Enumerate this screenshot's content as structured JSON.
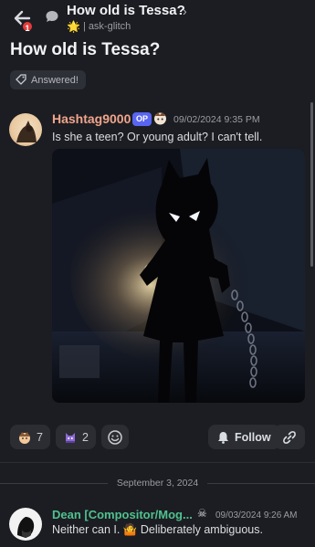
{
  "header": {
    "title": "How old is Tessa?",
    "chevron": "›",
    "notification_count": "1",
    "channel_emoji": "🌟",
    "channel_sep": "|",
    "channel": "ask-glitch"
  },
  "post": {
    "title": "How old is Tessa?",
    "status_badge": "Answered!",
    "author": "Hashtag9000",
    "op_label": "OP",
    "timestamp": "09/02/2024 9:35 PM",
    "message": "Is she a teen? Or young adult? I can't tell."
  },
  "reactions": [
    {
      "count": "7",
      "icon": "emoji-face-icon"
    },
    {
      "count": "2",
      "icon": "emoji-character-icon"
    }
  ],
  "actions": {
    "follow_label": "Follow",
    "add_reaction_icon": "smiley-add-icon",
    "link_icon": "link-icon"
  },
  "date_separator": "September 3, 2024",
  "reply": {
    "author": "Dean [Compositor/Mog...",
    "role_icon": "☠",
    "timestamp": "09/03/2024 9:26 AM",
    "message": "Neither can I. 🤷 Deliberately ambiguous."
  },
  "colors": {
    "background": "#1c1d22",
    "author_op": "#f0a58b",
    "author_reply": "#4fc190",
    "op_badge": "#5865f2",
    "notification": "#e53b3b"
  }
}
